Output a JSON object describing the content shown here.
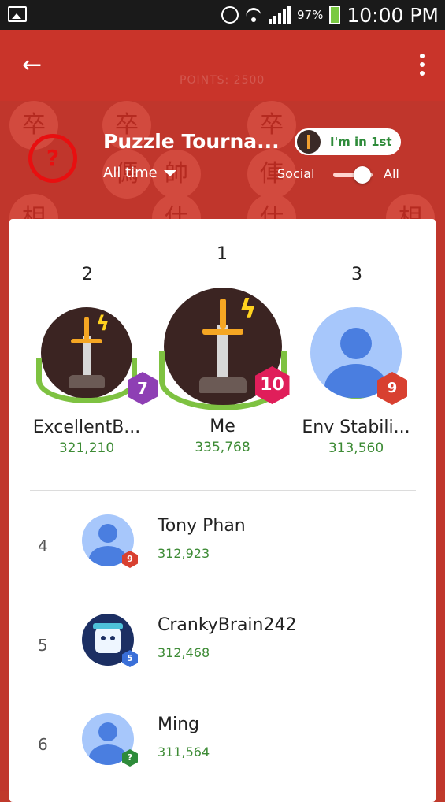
{
  "status_bar": {
    "battery_percent": "97%",
    "time": "10:00 PM"
  },
  "header": {
    "background_points": "POINTS: 2500",
    "title": "Puzzle Tourna...",
    "time_filter": "All time",
    "rank_pill": "I'm in 1st",
    "toggle_left_label": "Social",
    "toggle_right_label": "All",
    "toggle_on": true,
    "help_glyph": "?"
  },
  "board_glyphs": [
    "卒",
    "卒",
    "卒",
    "帥",
    "俥",
    "傌",
    "相",
    "仕",
    "仕",
    "相"
  ],
  "podium": [
    {
      "rank": "2",
      "name": "ExcellentB...",
      "score": "321,210",
      "level": "7",
      "level_color": "#8e3fb4",
      "avatar": "sword-icon"
    },
    {
      "rank": "1",
      "name": "Me",
      "score": "335,768",
      "level": "10",
      "level_color": "#e01e5a",
      "avatar": "sword-icon"
    },
    {
      "rank": "3",
      "name": "Env Stabili...",
      "score": "313,560",
      "level": "9",
      "level_color": "#d84030",
      "avatar": "person-icon"
    }
  ],
  "list": [
    {
      "rank": "4",
      "name": "Tony Phan",
      "score": "312,923",
      "level": "9",
      "level_color": "#d84030",
      "avatar": "person-icon"
    },
    {
      "rank": "5",
      "name": "CrankyBrain242",
      "score": "312,468",
      "level": "5",
      "level_color": "#3a6fd8",
      "avatar": "robot-icon"
    },
    {
      "rank": "6",
      "name": "Ming",
      "score": "311,564",
      "level": "?",
      "level_color": "#2e8b3a",
      "avatar": "person-icon"
    }
  ]
}
